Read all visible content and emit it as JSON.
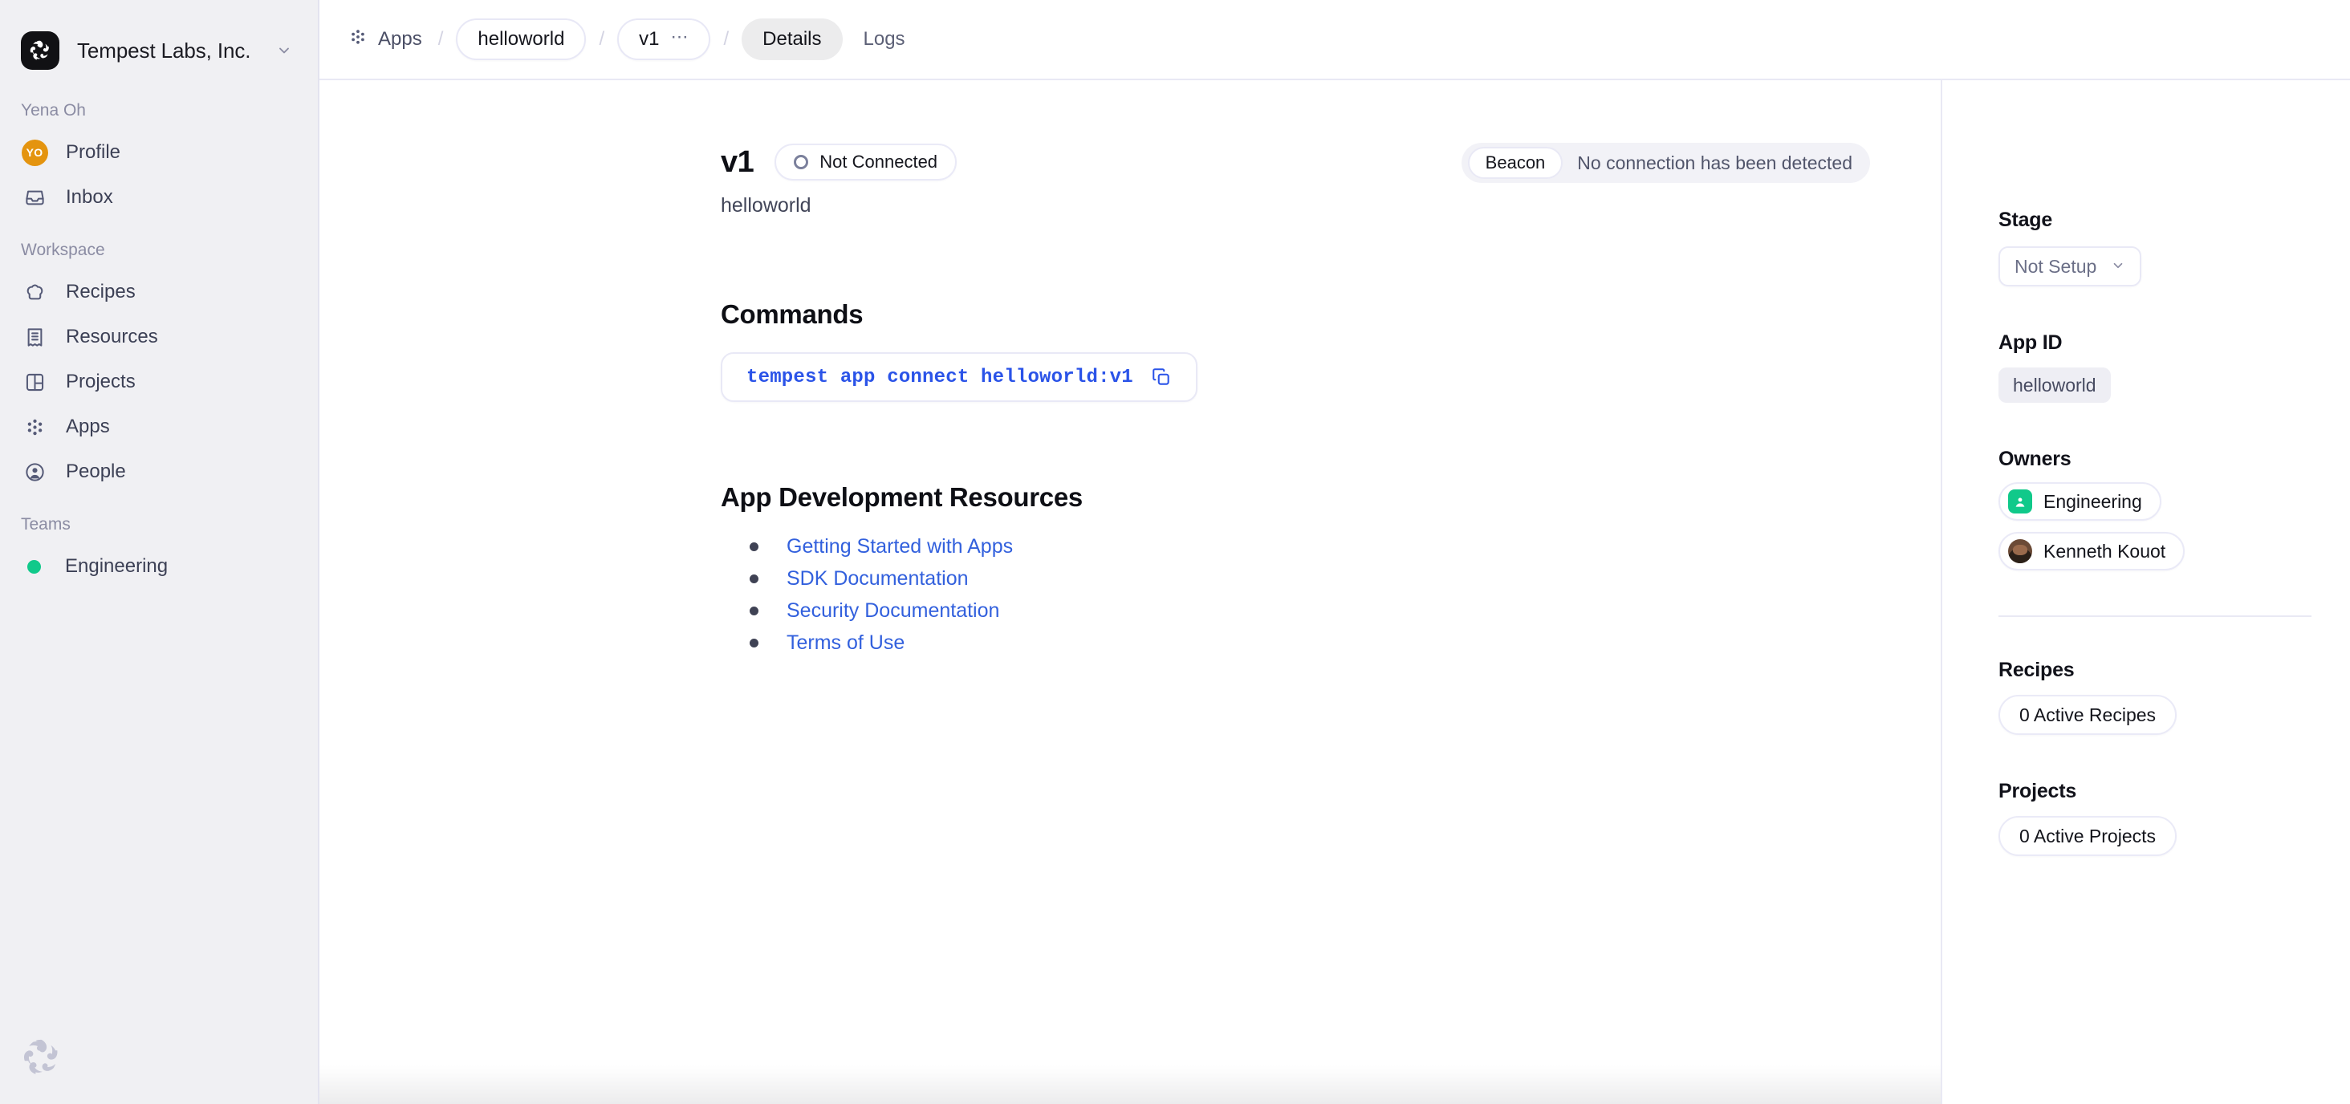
{
  "sidebar": {
    "org": {
      "name": "Tempest Labs, Inc.",
      "logo_icon": "tempest-spiral-logo",
      "chevron_icon": "chevron-down-icon"
    },
    "user_section_label": "Yena Oh",
    "user_items": [
      {
        "label": "Profile",
        "icon": "avatar-initials-icon",
        "initials": "YO",
        "color": "#e4940f"
      },
      {
        "label": "Inbox",
        "icon": "inbox-tray-icon"
      }
    ],
    "workspace_section_label": "Workspace",
    "workspace_items": [
      {
        "label": "Recipes",
        "icon": "chef-hat-icon"
      },
      {
        "label": "Resources",
        "icon": "document-list-icon"
      },
      {
        "label": "Projects",
        "icon": "layout-grid-icon"
      },
      {
        "label": "Apps",
        "icon": "apps-dots-icon"
      },
      {
        "label": "People",
        "icon": "person-circle-icon"
      }
    ],
    "teams_section_label": "Teams",
    "teams": [
      {
        "label": "Engineering",
        "icon": "status-dot-icon",
        "color": "#10c98a"
      }
    ],
    "watermark_icon": "tempest-spiral-watermark"
  },
  "topbar": {
    "apps_icon": "apps-dots-icon",
    "apps_label": "Apps",
    "separator": "/",
    "app_crumb": "helloworld",
    "version_crumb": "v1",
    "version_menu_icon": "ellipsis-horizontal-icon",
    "tabs": [
      {
        "label": "Details",
        "active": true
      },
      {
        "label": "Logs",
        "active": false
      }
    ]
  },
  "header": {
    "version": "v1",
    "status_badge": {
      "label": "Not Connected",
      "icon": "status-ring-icon"
    },
    "subtitle": "helloworld",
    "beacon": {
      "label": "Beacon",
      "message": "No connection has been detected"
    }
  },
  "commands": {
    "heading": "Commands",
    "command": "tempest app connect helloworld:v1",
    "copy_icon": "copy-icon"
  },
  "resources": {
    "heading": "App Development Resources",
    "links": [
      "Getting Started with Apps",
      "SDK Documentation",
      "Security Documentation",
      "Terms of Use"
    ]
  },
  "rightpanel": {
    "stage": {
      "label": "Stage",
      "value": "Not Setup",
      "chevron_icon": "chevron-down-icon"
    },
    "app_id": {
      "label": "App ID",
      "value": "helloworld"
    },
    "owners": {
      "label": "Owners",
      "items": [
        {
          "name": "Engineering",
          "type": "team",
          "icon": "team-badge-icon",
          "color": "#10c98a"
        },
        {
          "name": "Kenneth Kouot",
          "type": "person",
          "icon": "user-photo-avatar"
        }
      ]
    },
    "recipes": {
      "label": "Recipes",
      "value": "0 Active Recipes"
    },
    "projects": {
      "label": "Projects",
      "value": "0 Active Projects"
    }
  },
  "colors": {
    "sidebar_bg": "#f0f0f3",
    "content_bg": "#ffffff",
    "border": "#e9e9f4",
    "link": "#3260dd",
    "code": "#2a53e8",
    "accent_green": "#10c98a",
    "accent_orange": "#e4940f"
  }
}
